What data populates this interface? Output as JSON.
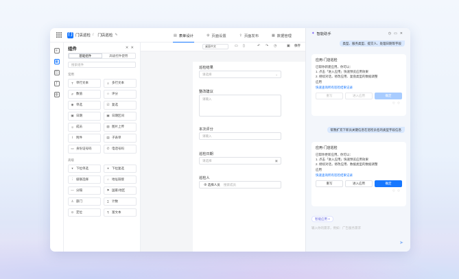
{
  "header": {
    "app_logo": "门",
    "crumb_app": "门店巡检",
    "crumb_page": "门店巡检",
    "tabs": [
      {
        "label": "表单设计",
        "icon": "form-icon"
      },
      {
        "label": "页面设置",
        "icon": "settings-icon"
      },
      {
        "label": "页面发布",
        "icon": "publish-icon"
      },
      {
        "label": "数据管理",
        "icon": "data-icon"
      }
    ]
  },
  "rail": {
    "icons": [
      "outline-icon",
      "components-icon",
      "data-source-icon",
      "formula-icon",
      "globe-icon"
    ]
  },
  "panel": {
    "title": "组件",
    "segments": [
      "基础组件",
      "高级控件使用"
    ],
    "search_placeholder": "搜索组件",
    "common_section": "常用",
    "common": [
      {
        "label": "单行文本",
        "icon": "text-icon"
      },
      {
        "label": "多行文本",
        "icon": "multiline-icon"
      },
      {
        "label": "数值",
        "icon": "number-icon"
      },
      {
        "label": "评分",
        "icon": "star-icon"
      },
      {
        "label": "单选",
        "icon": "radio-icon"
      },
      {
        "label": "复选",
        "icon": "checkbox-icon"
      },
      {
        "label": "日期",
        "icon": "calendar-icon"
      },
      {
        "label": "日期区间",
        "icon": "date-range-icon"
      },
      {
        "label": "成员",
        "icon": "user-icon"
      },
      {
        "label": "图片上传",
        "icon": "image-icon"
      },
      {
        "label": "附件",
        "icon": "paperclip-icon"
      },
      {
        "label": "子表单",
        "icon": "subform-icon"
      },
      {
        "label": "身份证号码",
        "icon": "id-card-icon"
      },
      {
        "label": "电话号码",
        "icon": "phone-icon"
      }
    ],
    "advanced_section": "高级",
    "advanced": [
      {
        "label": "下拉单选",
        "icon": "dropdown-icon"
      },
      {
        "label": "下拉复选",
        "icon": "dropdown-multi-icon"
      },
      {
        "label": "级联选择",
        "icon": "cascade-icon"
      },
      {
        "label": "地址链接",
        "icon": "address-icon"
      },
      {
        "label": "分隔",
        "icon": "divider-icon"
      },
      {
        "label": "国家/地区",
        "icon": "flag-icon"
      },
      {
        "label": "部门",
        "icon": "department-icon"
      },
      {
        "label": "计数",
        "icon": "counter-icon"
      },
      {
        "label": "定位",
        "icon": "location-icon"
      },
      {
        "label": "富文本",
        "icon": "rich-text-icon"
      }
    ]
  },
  "canvas": {
    "device_label": "桌面中文",
    "save_label": "保存",
    "fields": [
      {
        "label": "巡检结果",
        "placeholder": "请选择",
        "kind": "select"
      },
      {
        "label": "整改建议",
        "placeholder": "请输入",
        "kind": "textarea"
      },
      {
        "label": "本次评分",
        "placeholder": "请输入",
        "kind": "input"
      },
      {
        "label": "巡检日期",
        "placeholder": "请选择",
        "kind": "date"
      },
      {
        "label": "巡检人",
        "placeholder": "搜索成员",
        "button": "选择人员",
        "kind": "member"
      }
    ]
  },
  "assistant": {
    "title": "智能助手",
    "top_message": "类型、服务类型、提交人、处理日期等字段",
    "card1": {
      "title": "应用-门店巡检",
      "lines": [
        "已帮你新建应用，你可以：",
        "1. 点击「进入应用」快速预览应用效果",
        "2. 继续对话，修改应用、复盘类型的数据调整",
        "应用"
      ],
      "link": "快速查询所有巡检结果记录",
      "buttons": [
        "重写",
        "进入应用",
        "确定"
      ]
    },
    "user_message": "帮我扩充下新员关键信息在巡检员名的类型字段信息",
    "card2": {
      "title": "应用-门店巡检",
      "lines": [
        "已帮你更新应用，你可以：",
        "1. 点击「进入应用」快速预览应用效果",
        "2. 继续对话，修改应用、数据类型的数据调整",
        "应用"
      ],
      "link": "快速查询所有巡检结果记录",
      "buttons": [
        "重写",
        "进入应用",
        "确定"
      ]
    },
    "chip": "智能应用 ×",
    "input_placeholder": "输入你的需求，例如：广告服务需求"
  }
}
